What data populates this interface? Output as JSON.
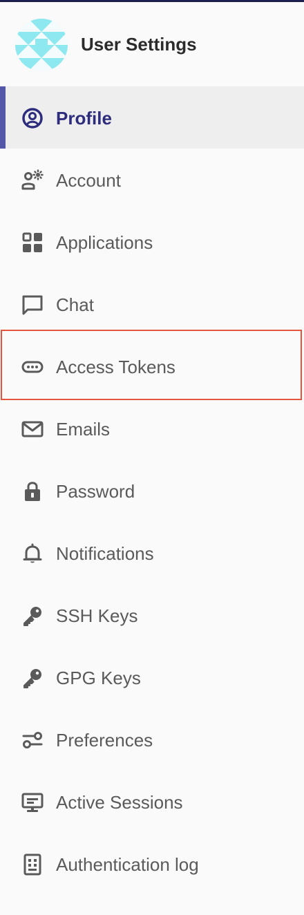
{
  "header": {
    "title": "User Settings"
  },
  "nav": {
    "items": [
      {
        "label": "Profile",
        "icon": "profile-icon",
        "active": true
      },
      {
        "label": "Account",
        "icon": "account-settings-icon",
        "active": false
      },
      {
        "label": "Applications",
        "icon": "applications-grid-icon",
        "active": false
      },
      {
        "label": "Chat",
        "icon": "chat-icon",
        "active": false
      },
      {
        "label": "Access Tokens",
        "icon": "token-icon",
        "active": false
      },
      {
        "label": "Emails",
        "icon": "mail-icon",
        "active": false
      },
      {
        "label": "Password",
        "icon": "lock-icon",
        "active": false
      },
      {
        "label": "Notifications",
        "icon": "bell-icon",
        "active": false
      },
      {
        "label": "SSH Keys",
        "icon": "key-icon",
        "active": false
      },
      {
        "label": "GPG Keys",
        "icon": "key-icon",
        "active": false
      },
      {
        "label": "Preferences",
        "icon": "preferences-icon",
        "active": false
      },
      {
        "label": "Active Sessions",
        "icon": "monitor-icon",
        "active": false
      },
      {
        "label": "Authentication log",
        "icon": "log-icon",
        "active": false
      }
    ]
  },
  "colors": {
    "active_accent": "#5456a8",
    "active_text": "#2e2d7d",
    "highlight_border": "#e5533c",
    "avatar_pattern": "#8de8f0"
  }
}
